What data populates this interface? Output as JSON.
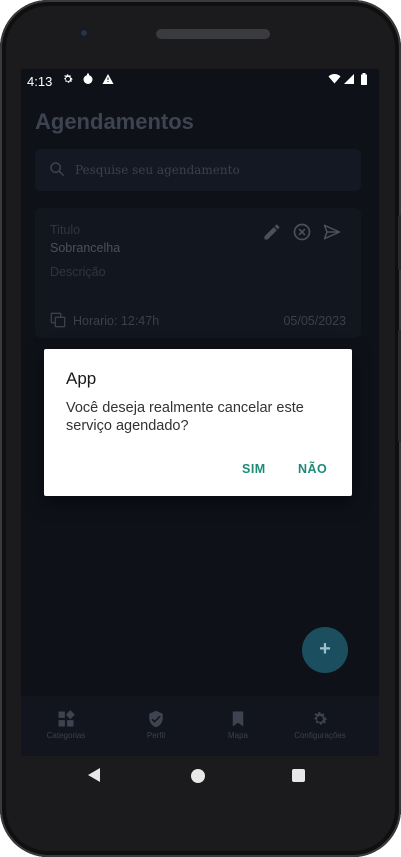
{
  "status_bar": {
    "time": "4:13",
    "left_icons": [
      "gear-icon",
      "circle-icon",
      "warning-icon"
    ],
    "right_icons": [
      "wifi-icon",
      "signal-icon",
      "battery-icon"
    ]
  },
  "page": {
    "title": "Agendamentos"
  },
  "search": {
    "placeholder": "Pesquise seu agendamento"
  },
  "card": {
    "title_label": "Titulo",
    "title_value": "Sobrancelha",
    "description_label": "Descrição",
    "time_text": "Horario: 12:47h",
    "date": "05/05/2023",
    "action_icons": [
      "pencil-icon",
      "cancel-circle-icon",
      "send-icon"
    ]
  },
  "dialog": {
    "title": "App",
    "message": "Você deseja realmente cancelar este serviço agendado?",
    "yes_label": "SIM",
    "no_label": "NÃO"
  },
  "fab": {
    "label": "+"
  },
  "tabs": [
    {
      "label": "Categorias",
      "icon": "grid-icon"
    },
    {
      "label": "Perfil",
      "icon": "shield-check-icon"
    },
    {
      "label": "Mapa",
      "icon": "bookmark-icon"
    },
    {
      "label": "Configurações",
      "icon": "gear-icon"
    }
  ],
  "colors": {
    "accent": "#1f8a78",
    "screen_bg": "#0e1118",
    "fab_bg": "#1b4f60"
  }
}
